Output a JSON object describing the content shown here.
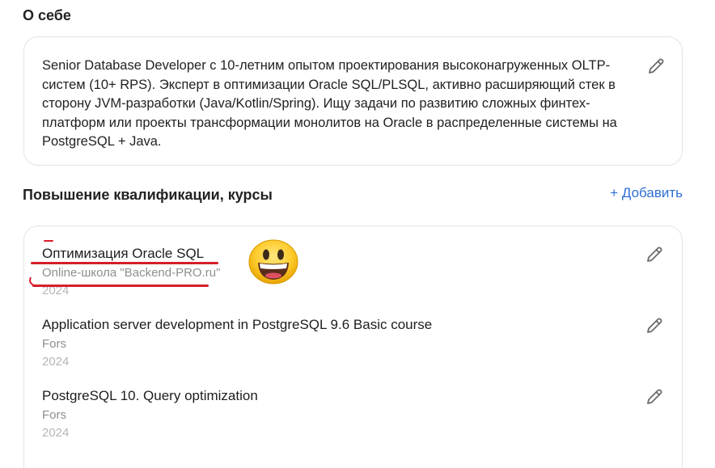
{
  "about": {
    "title": "О себе",
    "text": "Senior Database Developer с 10-летним опытом проектирования высоконагруженных OLTP-систем (10+ RPS). Эксперт в оптимизации Oracle SQL/PLSQL, активно расширяющий стек в сторону JVM-разработки (Java/Kotlin/Spring). Ищу задачи по развитию сложных финтех-платформ или проекты трансформации монолитов на Oracle в распределенные системы на PostgreSQL + Java."
  },
  "courses": {
    "title": "Повышение квалификации, курсы",
    "add_label": "+ Добавить",
    "items": [
      {
        "title": "Оптимизация Oracle SQL",
        "org": "Online-школа \"Backend-PRO.ru\"",
        "year": "2024"
      },
      {
        "title": "Application server development in PostgreSQL 9.6 Basic course",
        "org": "Fors",
        "year": "2024"
      },
      {
        "title": "PostgreSQL 10. Query optimization",
        "org": "Fors",
        "year": "2024"
      }
    ]
  },
  "colors": {
    "accent": "#2f6fd6",
    "annotation": "#d61e2a",
    "muted": "#8e8e8e",
    "year": "#b6b6b6"
  },
  "icons": {
    "edit": "pencil-icon",
    "emoji": "smiley-icon"
  }
}
